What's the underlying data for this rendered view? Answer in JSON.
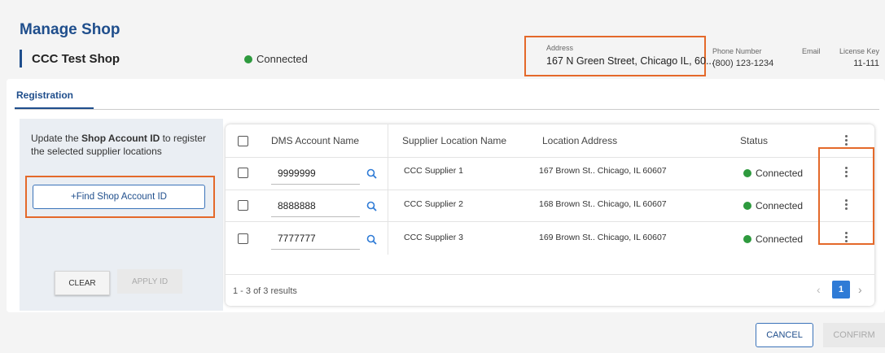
{
  "header": {
    "title": "Manage Shop",
    "shop_name": "CCC Test Shop",
    "connection_status": "Connected",
    "address_label": "Address",
    "address_value": "167 N Green Street, Chicago IL, 60...",
    "phone_label": "Phone Number",
    "phone_value": "(800) 123-1234",
    "email_label": "Email",
    "license_label": "License Key",
    "license_value": "11-111"
  },
  "tabs": [
    {
      "label": "Registration"
    }
  ],
  "left_panel": {
    "instruction_prefix": "Update the ",
    "instruction_bold": "Shop Account ID",
    "instruction_suffix": " to register the selected supplier locations",
    "find_button": "+Find Shop Account ID",
    "clear_button": "CLEAR",
    "apply_button": "APPLY ID"
  },
  "table": {
    "columns": [
      "DMS Account Name",
      "Supplier Location Name",
      "Location Address",
      "Status"
    ],
    "rows": [
      {
        "account": "9999999",
        "supplier": "CCC Supplier 1",
        "address": "167 Brown St.. Chicago, IL 60607",
        "status": "Connected"
      },
      {
        "account": "8888888",
        "supplier": "CCC Supplier 2",
        "address": "168 Brown St.. Chicago, IL 60607",
        "status": "Connected"
      },
      {
        "account": "7777777",
        "supplier": "CCC Supplier 3",
        "address": "169 Brown St.. Chicago, IL 60607",
        "status": "Connected"
      }
    ],
    "results_text": "1 - 3 of 3 results",
    "current_page": "1"
  },
  "footer": {
    "cancel_button": "CANCEL",
    "confirm_button": "CONFIRM"
  },
  "colors": {
    "brand_blue": "#1f4e8c",
    "connected_green": "#2e9a3e",
    "highlight_orange": "#e4692a",
    "page_active": "#2f7bd6"
  }
}
